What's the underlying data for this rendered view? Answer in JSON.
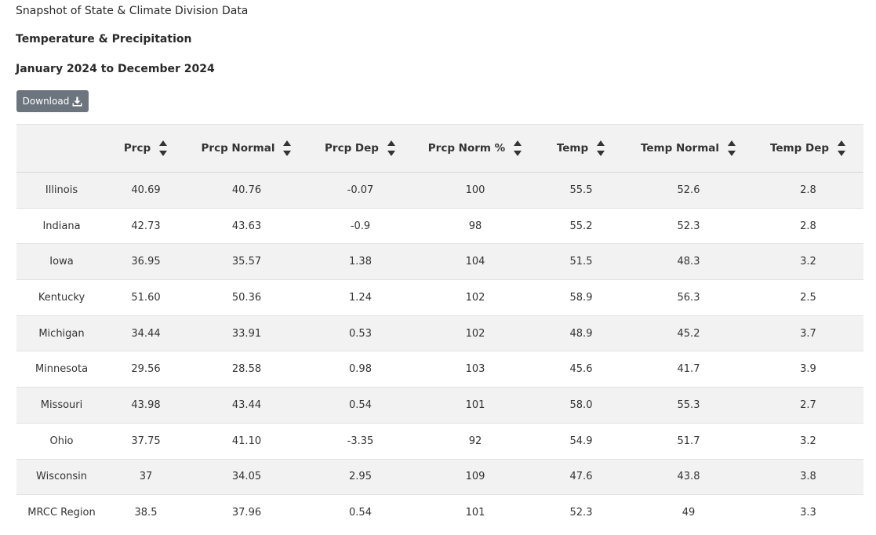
{
  "header": {
    "title": "Snapshot of State & Climate Division Data",
    "subtitle": "Temperature & Precipitation",
    "date_range": "January 2024 to December 2024"
  },
  "toolbar": {
    "download_label": "Download",
    "download_icon": "download-icon",
    "button_color": "#6c757d"
  },
  "table": {
    "columns": [
      "",
      "Prcp",
      "Prcp Normal",
      "Prcp Dep",
      "Prcp Norm %",
      "Temp",
      "Temp Normal",
      "Temp Dep"
    ],
    "sort_icon": "sort-updown-icon",
    "rows": [
      [
        "Illinois",
        "40.69",
        "40.76",
        "-0.07",
        "100",
        "55.5",
        "52.6",
        "2.8"
      ],
      [
        "Indiana",
        "42.73",
        "43.63",
        "-0.9",
        "98",
        "55.2",
        "52.3",
        "2.8"
      ],
      [
        "Iowa",
        "36.95",
        "35.57",
        "1.38",
        "104",
        "51.5",
        "48.3",
        "3.2"
      ],
      [
        "Kentucky",
        "51.60",
        "50.36",
        "1.24",
        "102",
        "58.9",
        "56.3",
        "2.5"
      ],
      [
        "Michigan",
        "34.44",
        "33.91",
        "0.53",
        "102",
        "48.9",
        "45.2",
        "3.7"
      ],
      [
        "Minnesota",
        "29.56",
        "28.58",
        "0.98",
        "103",
        "45.6",
        "41.7",
        "3.9"
      ],
      [
        "Missouri",
        "43.98",
        "43.44",
        "0.54",
        "101",
        "58.0",
        "55.3",
        "2.7"
      ],
      [
        "Ohio",
        "37.75",
        "41.10",
        "-3.35",
        "92",
        "54.9",
        "51.7",
        "3.2"
      ],
      [
        "Wisconsin",
        "37",
        "34.05",
        "2.95",
        "109",
        "47.6",
        "43.8",
        "3.8"
      ],
      [
        "MRCC Region",
        "38.5",
        "37.96",
        "0.54",
        "101",
        "52.3",
        "49",
        "3.3"
      ]
    ]
  }
}
